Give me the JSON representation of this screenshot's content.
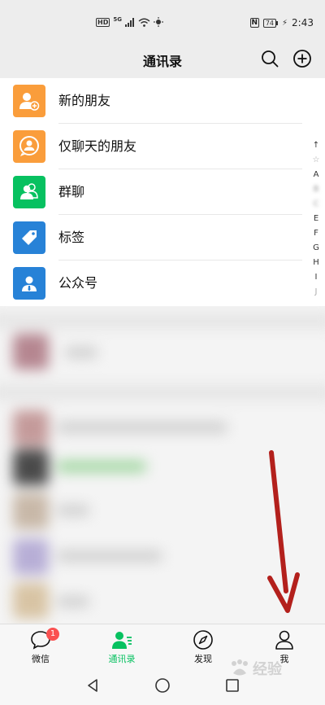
{
  "status_bar": {
    "hd_label": "HD",
    "network_label": "5G",
    "nfc_label": "N",
    "battery_level": "74",
    "time": "2:43"
  },
  "header": {
    "title": "通讯录",
    "search_icon": "search-icon",
    "add_icon": "add-circle-icon"
  },
  "list_items": [
    {
      "label": "新的朋友",
      "icon": "new-friend-icon",
      "color": "#fa9d3b"
    },
    {
      "label": "仅聊天的朋友",
      "icon": "chat-only-friend-icon",
      "color": "#fa9d3b"
    },
    {
      "label": "群聊",
      "icon": "group-chat-icon",
      "color": "#07c160"
    },
    {
      "label": "标签",
      "icon": "tag-icon",
      "color": "#2782d7"
    },
    {
      "label": "公众号",
      "icon": "official-account-icon",
      "color": "#2782d7"
    }
  ],
  "index_bar": [
    "↑",
    "☆",
    "A",
    "E",
    "F",
    "G",
    "H",
    "I",
    "J"
  ],
  "tab_bar": {
    "tabs": [
      {
        "label": "微信",
        "icon": "chat-bubble-icon",
        "badge": "1",
        "active": false
      },
      {
        "label": "通讯录",
        "icon": "contacts-icon",
        "active": true
      },
      {
        "label": "发现",
        "icon": "compass-icon",
        "active": false
      },
      {
        "label": "我",
        "icon": "person-icon",
        "active": false
      }
    ]
  },
  "colors": {
    "accent": "#07c160",
    "badge": "#fa5151",
    "arrow": "#b3201c"
  },
  "watermark": "经验"
}
